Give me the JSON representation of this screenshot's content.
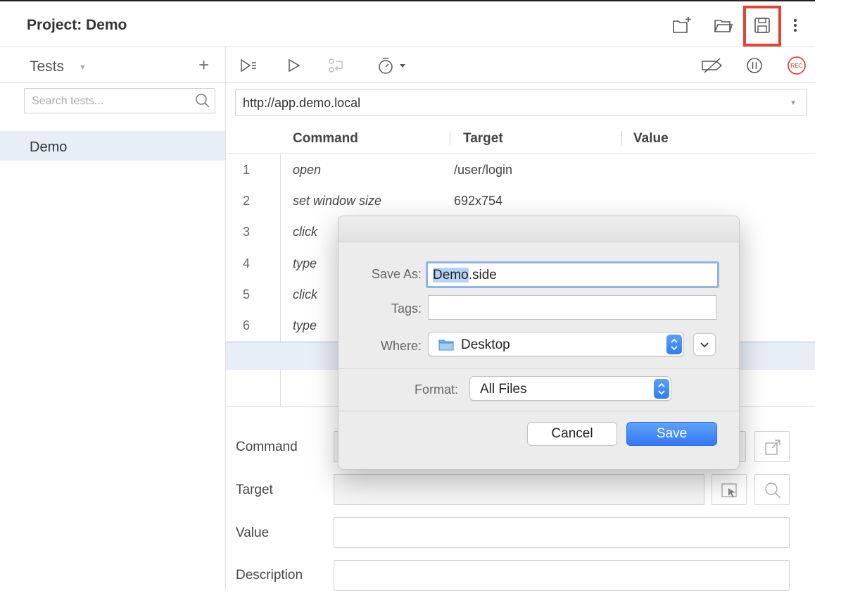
{
  "header": {
    "project_label": "Project:",
    "project_name": "Demo",
    "icons": [
      "new-project-icon",
      "open-project-icon",
      "save-project-icon",
      "more-options-icon"
    ]
  },
  "sidebar": {
    "tests_label": "Tests",
    "add_symbol": "+",
    "search_placeholder": "Search tests...",
    "tests": [
      {
        "label": "Demo"
      }
    ]
  },
  "toolbar": {
    "icons": [
      "run-all-tests-icon",
      "run-test-icon",
      "step-icon",
      "speed-icon",
      "disable-breakpoints-icon",
      "pause-icon",
      "record-icon"
    ],
    "record_label": "REC"
  },
  "url_bar": {
    "value": "http://app.demo.local"
  },
  "table": {
    "columns": [
      "Command",
      "Target",
      "Value"
    ],
    "rows": [
      {
        "num": "1",
        "command": "open",
        "target": "/user/login",
        "value": ""
      },
      {
        "num": "2",
        "command": "set window size",
        "target": "692x754",
        "value": ""
      },
      {
        "num": "3",
        "command": "click",
        "target": "",
        "value": ""
      },
      {
        "num": "4",
        "command": "type",
        "target": "",
        "value": ""
      },
      {
        "num": "5",
        "command": "click",
        "target": "",
        "value": ""
      },
      {
        "num": "6",
        "command": "type",
        "target": "",
        "value": ""
      }
    ]
  },
  "form": {
    "command_label": "Command",
    "target_label": "Target",
    "value_label": "Value",
    "description_label": "Description"
  },
  "dialog": {
    "save_as_label": "Save As:",
    "filename_selected": "Demo",
    "filename_ext": ".side",
    "tags_label": "Tags:",
    "tags_value": "",
    "where_label": "Where:",
    "where_value": "Desktop",
    "format_label": "Format:",
    "format_value": "All Files",
    "cancel_label": "Cancel",
    "save_label": "Save"
  },
  "colors": {
    "highlight_border": "#e8422e",
    "accent_blue": "#3478f6",
    "selected_row": "#e8eef6",
    "record_red": "#e0322a"
  }
}
